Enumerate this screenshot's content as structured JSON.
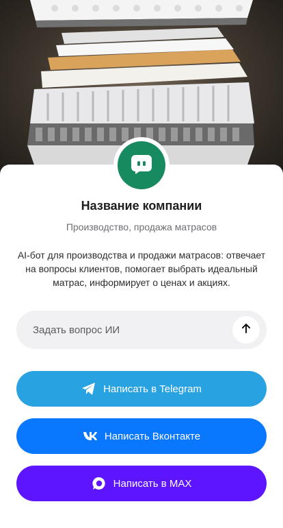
{
  "company": {
    "name": "Название компании",
    "subtitle": "Производство, продажа матрасов",
    "description": "AI-бот для производства и продажи матрасов: отвечает на вопросы клиентов, помогает выбрать идеальный матрас, информирует о ценах и акциях."
  },
  "ask": {
    "placeholder": "Задать вопрос ИИ",
    "send_icon": "arrow-up-icon"
  },
  "buttons": {
    "telegram": {
      "label": "Написать в Telegram",
      "icon": "telegram-icon",
      "color": "#28a2e1"
    },
    "vk": {
      "label": "Написать Вконтакте",
      "icon": "vk-icon",
      "color": "#0a77ff"
    },
    "max": {
      "label": "Написать в MAX",
      "icon": "max-icon",
      "color": "#5d15ff"
    }
  },
  "avatar": {
    "icon": "chat-bot-icon",
    "color": "#178a60"
  }
}
